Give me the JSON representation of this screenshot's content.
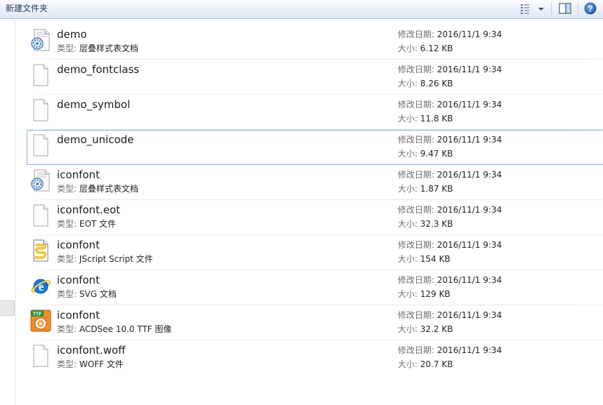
{
  "toolbar": {
    "new_folder_label": "新建文件夹",
    "view_icon": "view-details-icon",
    "dropdown_icon": "chevron-down-icon",
    "preview_icon": "preview-pane-icon",
    "help_icon": "help-icon",
    "help_symbol": "?"
  },
  "labels": {
    "modified": "修改日期:",
    "size": "大小:",
    "type": "类型:"
  },
  "colors": {
    "toolbar_text": "#1e395b",
    "focus_border": "#8fb0d9",
    "help_blue": "#2a64b8"
  },
  "files": [
    {
      "name": "demo",
      "type": "层叠样式表文档",
      "modified": "2016/11/1 9:34",
      "size": "6.12 KB",
      "icon": "css-file-icon"
    },
    {
      "name": "demo_fontclass",
      "type": "",
      "modified": "2016/11/1 9:34",
      "size": "8.26 KB",
      "icon": "blank-file-icon"
    },
    {
      "name": "demo_symbol",
      "type": "",
      "modified": "2016/11/1 9:34",
      "size": "11.8 KB",
      "icon": "blank-file-icon"
    },
    {
      "name": "demo_unicode",
      "type": "",
      "modified": "2016/11/1 9:34",
      "size": "9.47 KB",
      "icon": "blank-file-icon",
      "focused": true
    },
    {
      "name": "iconfont",
      "type": "层叠样式表文档",
      "modified": "2016/11/1 9:34",
      "size": "1.87 KB",
      "icon": "css-file-icon"
    },
    {
      "name": "iconfont.eot",
      "type": "EOT 文件",
      "modified": "2016/11/1 9:34",
      "size": "32.3 KB",
      "icon": "blank-file-icon"
    },
    {
      "name": "iconfont",
      "type": "JScript Script 文件",
      "modified": "2016/11/1 9:34",
      "size": "154 KB",
      "icon": "jscript-file-icon"
    },
    {
      "name": "iconfont",
      "type": "SVG 文档",
      "modified": "2016/11/1 9:34",
      "size": "129 KB",
      "icon": "internet-explorer-icon"
    },
    {
      "name": "iconfont",
      "type": "ACDSee 10.0 TTF 图像",
      "modified": "2016/11/1 9:34",
      "size": "32.2 KB",
      "icon": "ttf-font-file-icon",
      "badge": "TTF"
    },
    {
      "name": "iconfont.woff",
      "type": "WOFF 文件",
      "modified": "2016/11/1 9:34",
      "size": "20.7 KB",
      "icon": "blank-file-icon"
    }
  ]
}
